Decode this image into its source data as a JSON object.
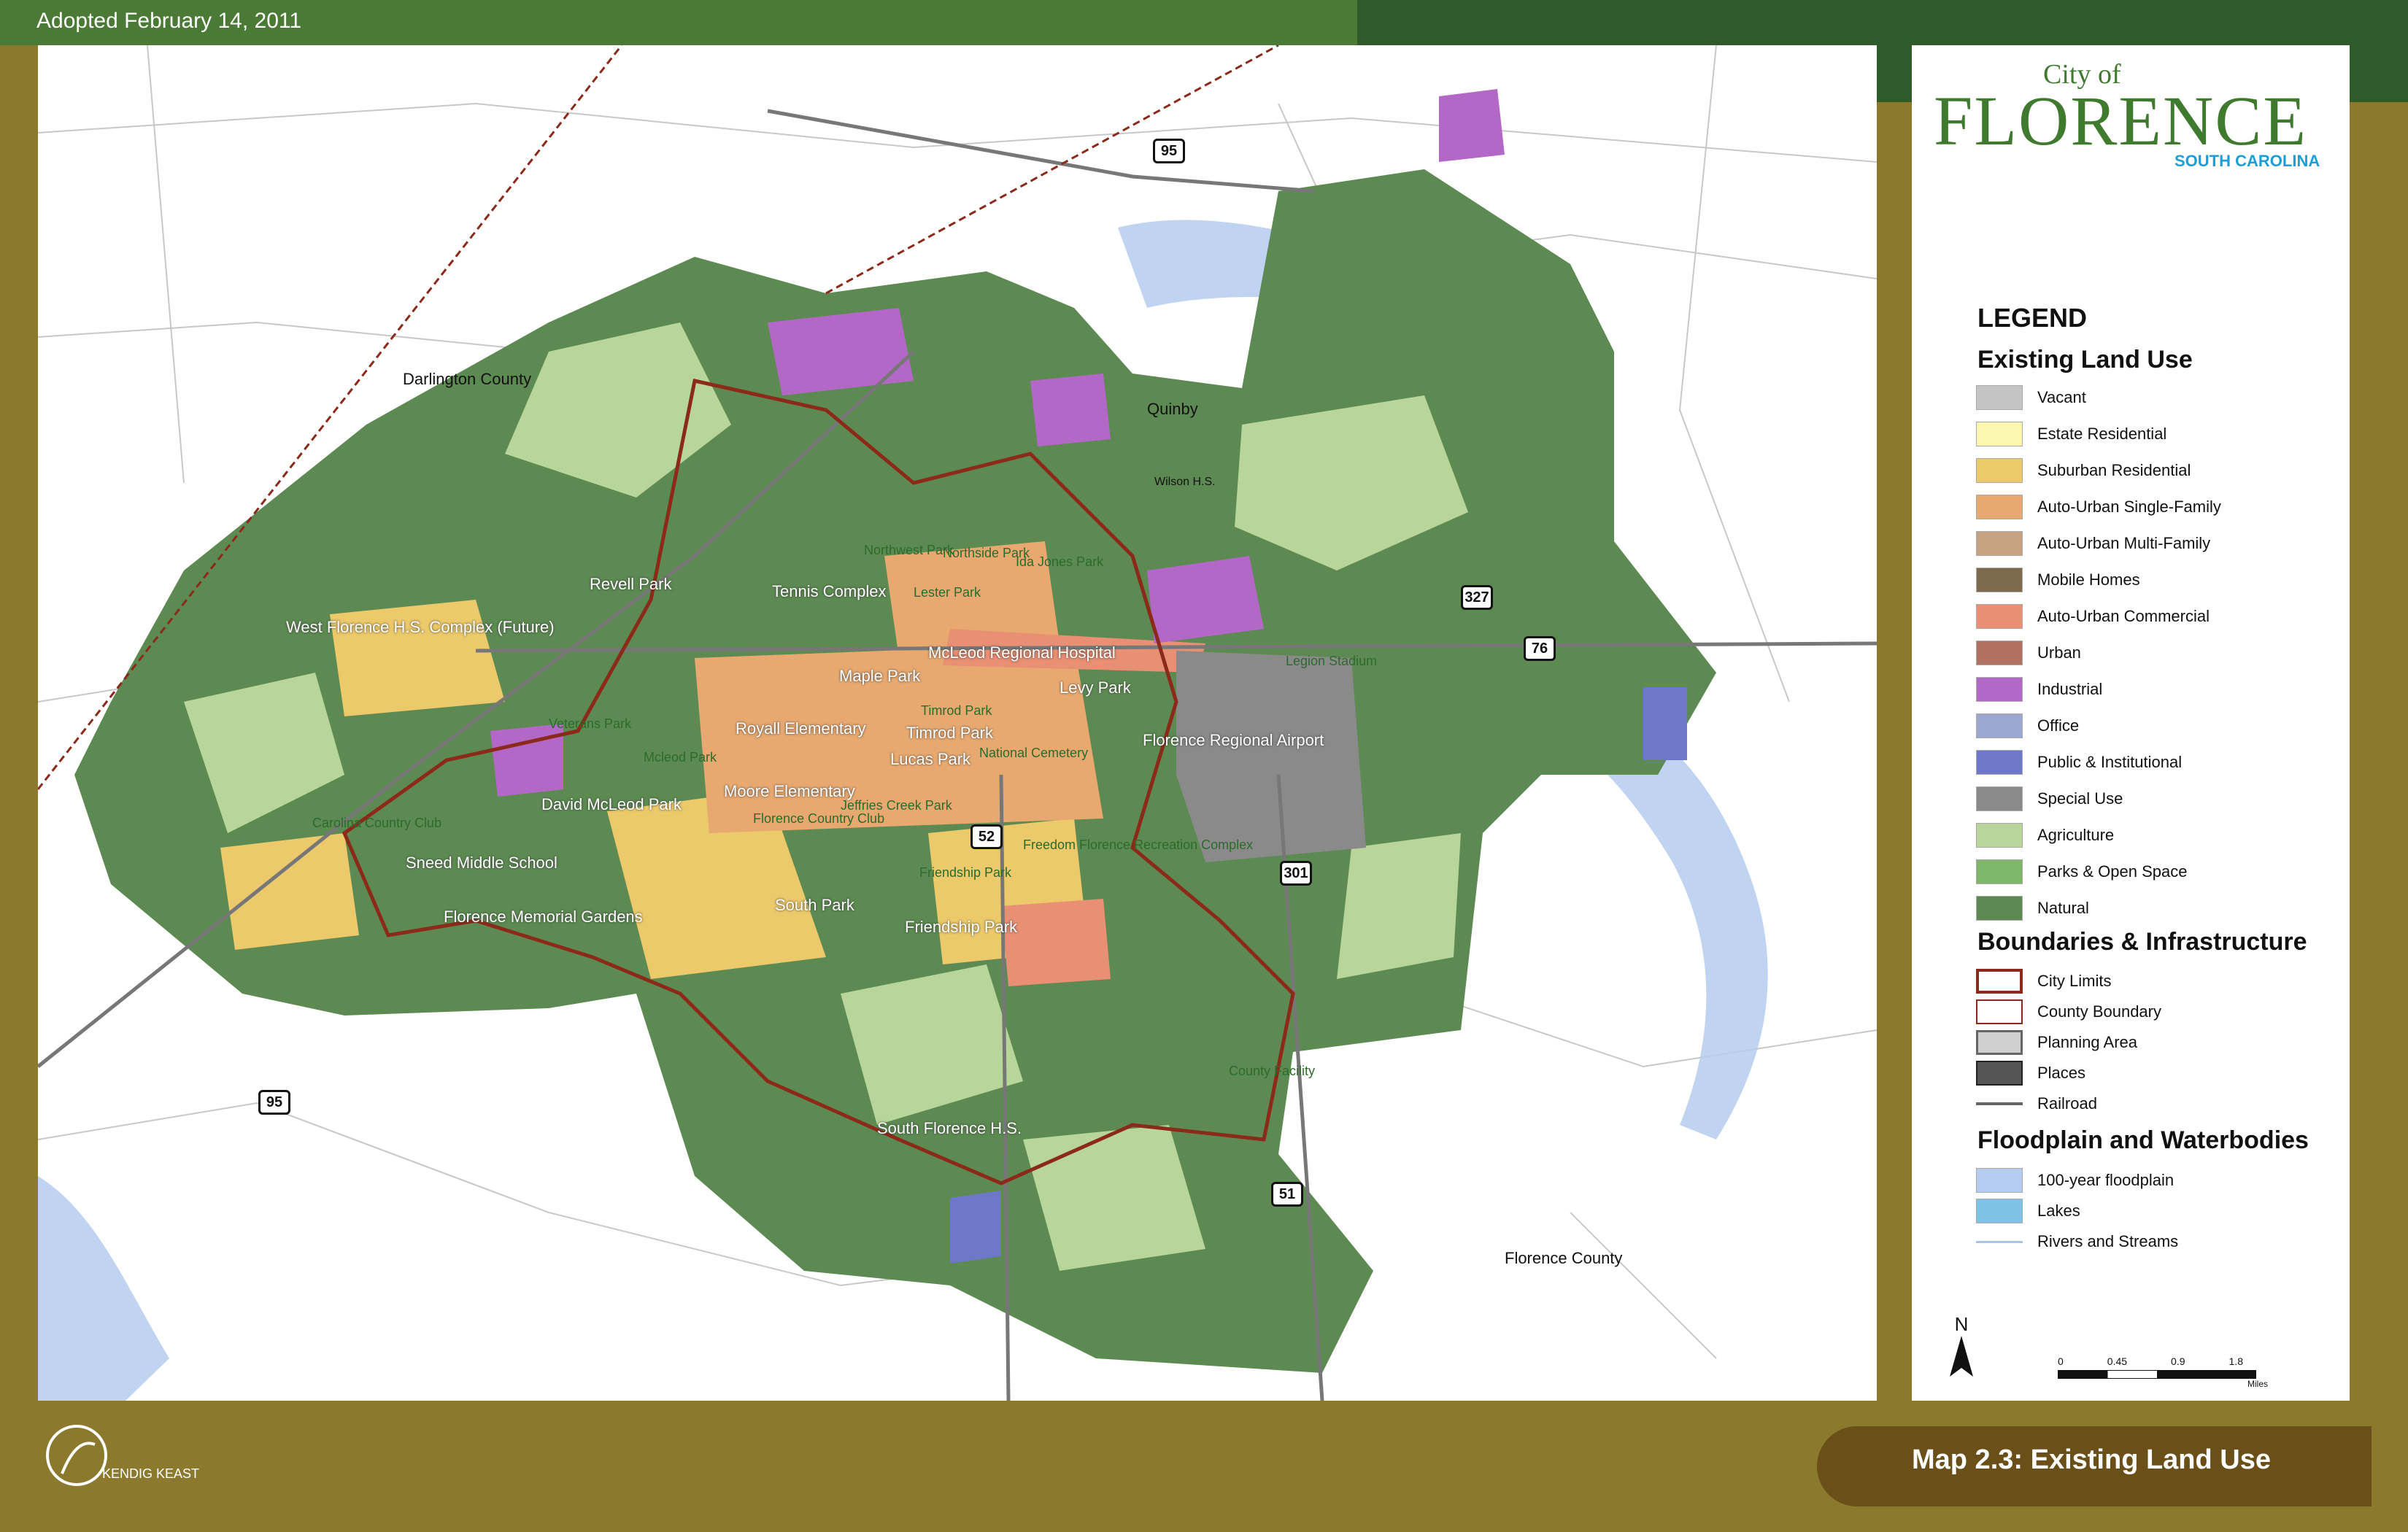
{
  "header": {
    "adopted": "Adopted February 14, 2011"
  },
  "logo": {
    "line1": "City of",
    "line2": "FLORENCE",
    "line3": "SOUTH CAROLINA"
  },
  "legend": {
    "title": "LEGEND",
    "land_use_heading": "Existing Land Use",
    "land_use": [
      {
        "label": "Vacant",
        "color": "#c4c4c4"
      },
      {
        "label": "Estate Residential",
        "color": "#fbf7b0"
      },
      {
        "label": "Suburban Residential",
        "color": "#ecc96a"
      },
      {
        "label": "Auto-Urban Single-Family",
        "color": "#e8a970"
      },
      {
        "label": "Auto-Urban Multi-Family",
        "color": "#c7a383"
      },
      {
        "label": "Mobile Homes",
        "color": "#7c6a4c"
      },
      {
        "label": "Auto-Urban Commercial",
        "color": "#e98f73"
      },
      {
        "label": "Urban",
        "color": "#b17060"
      },
      {
        "label": "Industrial",
        "color": "#b368c8"
      },
      {
        "label": "Office",
        "color": "#9ca7cf"
      },
      {
        "label": "Public & Institutional",
        "color": "#6f77c8"
      },
      {
        "label": "Special Use",
        "color": "#8a8a8a"
      },
      {
        "label": "Agriculture",
        "color": "#b8d59a"
      },
      {
        "label": "Parks & Open Space",
        "color": "#7fb86a"
      },
      {
        "label": "Natural",
        "color": "#5d8a52"
      }
    ],
    "boundaries_heading": "Boundaries & Infrastructure",
    "boundaries": [
      {
        "label": "City Limits",
        "color": "#8b2a1a"
      },
      {
        "label": "County Boundary",
        "color": "#8b2a1a"
      },
      {
        "label": "Planning Area",
        "color": "#9a9a9a"
      },
      {
        "label": "Places",
        "color": "#555555"
      },
      {
        "label": "Railroad",
        "color": "#666666"
      }
    ],
    "water_heading": "Floodplain and Waterbodies",
    "water": [
      {
        "label": "100-year floodplain",
        "color": "#b5ccf0"
      },
      {
        "label": "Lakes",
        "color": "#7ec3e6"
      },
      {
        "label": "Rivers and Streams",
        "color": "#a9c4e6"
      }
    ]
  },
  "north": "N",
  "scale": {
    "ticks": [
      "0",
      "0.45",
      "0.9",
      "1.8"
    ],
    "unit": "Miles"
  },
  "caption": "Map 2.3: Existing Land Use",
  "credit": "KENDIG KEAST",
  "map_labels": {
    "darlington_county": "Darlington County",
    "florence_county": "Florence County",
    "quinby": "Quinby",
    "wilson_hs": "Wilson H.S.",
    "revell_park": "Revell Park",
    "west_florence": "West Florence H.S. Complex (Future)",
    "tennis_complex": "Tennis Complex",
    "northwest_park": "Northwest Park",
    "northside_park": "Northside Park",
    "ida_jones_park": "Ida Jones Park",
    "lester_park": "Lester Park",
    "mcleod_hospital": "McLeod Regional Hospital",
    "maple_park": "Maple Park",
    "levy_park": "Levy Park",
    "legion_stadium": "Legion Stadium",
    "veterans_park": "Veterans Park",
    "royall_elementary": "Royall Elementary",
    "timrod_park": "Timrod Park",
    "timrod_park_small": "Timrod Park",
    "lucas_park": "Lucas Park",
    "national_cemetery": "National Cemetery",
    "florence_airport": "Florence Regional Airport",
    "mcleod_park": "Mcleod Park",
    "david_mcleod_park": "David McLeod Park",
    "moore_elementary": "Moore Elementary",
    "florence_country_club": "Florence Country Club",
    "jeffries_creek_park": "Jeffries Creek Park",
    "carolina_country_club": "Carolina Country Club",
    "sneed_middle": "Sneed Middle School",
    "freedom_florence": "Freedom Florence Recreation Complex",
    "friendship_park_small": "Friendship Park",
    "south_park": "South Park",
    "friendship_park": "Friendship Park",
    "florence_memorial": "Florence Memorial Gardens",
    "county_facility": "County Facility",
    "south_florence_hs": "South Florence H.S."
  },
  "highways": {
    "i95_north": "95",
    "i95_south": "95",
    "us327": "327",
    "us76": "76",
    "us52": "52",
    "us301": "301",
    "us51": "51"
  }
}
